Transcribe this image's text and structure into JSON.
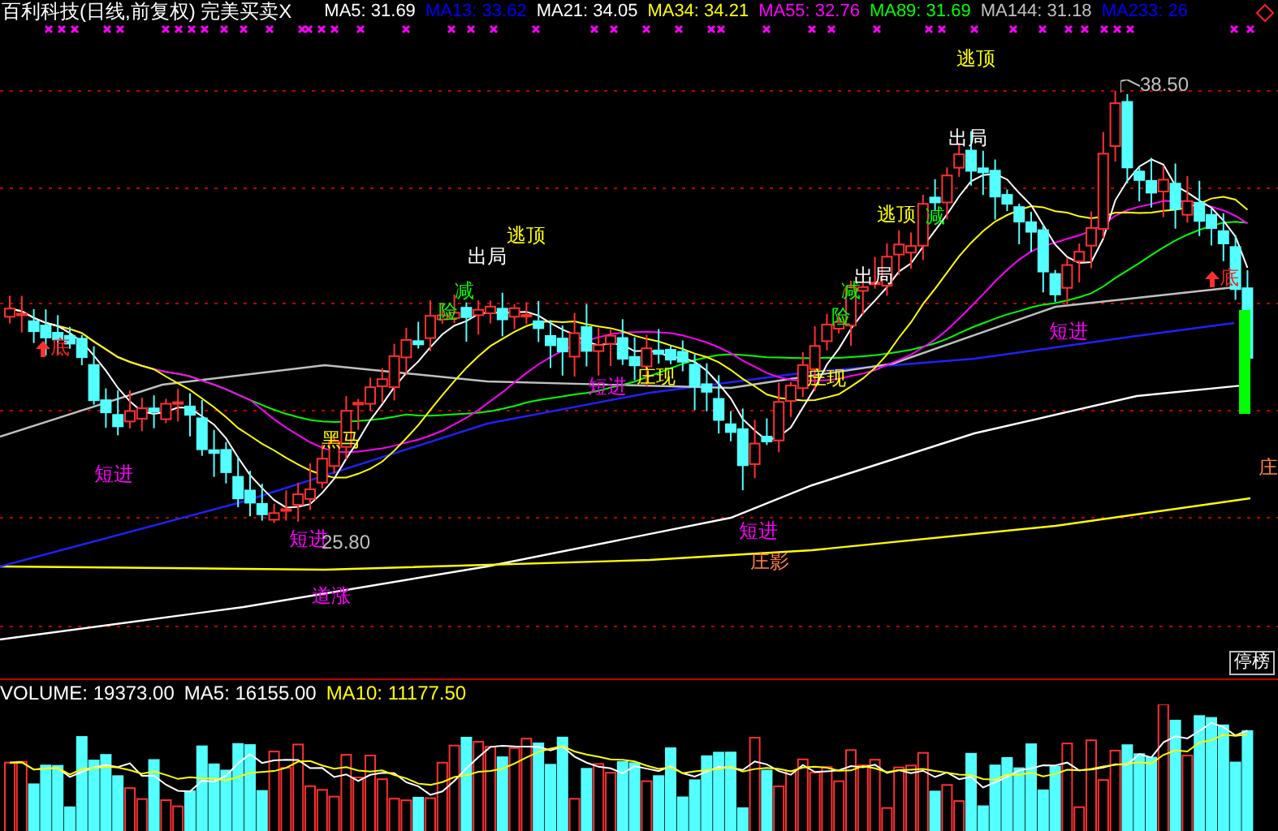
{
  "title": "百利科技(日线,前复权) 完美买卖X",
  "indicators": [
    {
      "label": "MA5: 31.69",
      "color": "#ffffff"
    },
    {
      "label": "MA13: 33.62",
      "color": "#0000ff"
    },
    {
      "label": "MA21: 34.05",
      "color": "#ffffff"
    },
    {
      "label": "MA34: 34.21",
      "color": "#ffff00"
    },
    {
      "label": "MA55: 32.76",
      "color": "#ff00ff"
    },
    {
      "label": "MA89: 31.69",
      "color": "#00ff00"
    },
    {
      "label": "MA144: 31.18",
      "color": "#c0c0c0"
    },
    {
      "label": "MA233: 26",
      "color": "#0000ff"
    }
  ],
  "annotations": [
    {
      "text": "底",
      "color": "#ff2020",
      "kind": "arrow"
    },
    {
      "text": "短进",
      "color": "#ff00ff",
      "kind": "plain"
    },
    {
      "text": "黑马",
      "color": "#ffff00",
      "kind": "plain"
    },
    {
      "text": "短进",
      "color": "#ff00ff",
      "kind": "plain"
    },
    {
      "text": "25.80",
      "color": "#c0c0c0",
      "kind": "plain"
    },
    {
      "text": "道涨",
      "color": "#ff00ff",
      "kind": "plain"
    },
    {
      "text": "险",
      "color": "#00ff00",
      "kind": "plain"
    },
    {
      "text": "减",
      "color": "#00ff00",
      "kind": "plain"
    },
    {
      "text": "出局",
      "color": "#ffffff",
      "kind": "plain"
    },
    {
      "text": "逃顶",
      "color": "#ffff00",
      "kind": "plain"
    },
    {
      "text": "短进",
      "color": "#ff00ff",
      "kind": "plain"
    },
    {
      "text": "庄现",
      "color": "#ffff00",
      "kind": "plain"
    },
    {
      "text": "短进",
      "color": "#ff00ff",
      "kind": "plain"
    },
    {
      "text": "庄影",
      "color": "#ff8040",
      "kind": "plain"
    },
    {
      "text": "庄现",
      "color": "#ffff00",
      "kind": "plain"
    },
    {
      "text": "险",
      "color": "#00ff00",
      "kind": "plain"
    },
    {
      "text": "减",
      "color": "#00ff00",
      "kind": "plain"
    },
    {
      "text": "出局",
      "color": "#ffffff",
      "kind": "plain"
    },
    {
      "text": "逃顶",
      "color": "#ffff00",
      "kind": "plain"
    },
    {
      "text": "减",
      "color": "#00ff00",
      "kind": "plain"
    },
    {
      "text": "出局",
      "color": "#ffffff",
      "kind": "plain"
    },
    {
      "text": "逃顶",
      "color": "#ffff00",
      "kind": "plain"
    },
    {
      "text": "38.50",
      "color": "#c0c0c0",
      "kind": "peak"
    },
    {
      "text": "短进",
      "color": "#ff00ff",
      "kind": "plain"
    },
    {
      "text": "底",
      "color": "#ff2020",
      "kind": "arrow"
    },
    {
      "text": "庄",
      "color": "#ff8040",
      "kind": "plain"
    }
  ],
  "stop_button": "停榜",
  "volume": [
    {
      "label": "VOLUME: 19373.00",
      "color": "#ffffff"
    },
    {
      "label": "MA5: 16155.00",
      "color": "#ffffff"
    },
    {
      "label": "MA10: 11177.50",
      "color": "#ffff00"
    }
  ]
}
